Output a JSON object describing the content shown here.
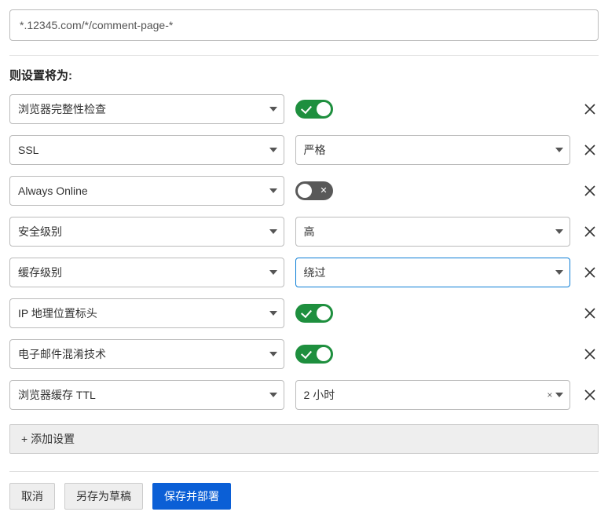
{
  "url_pattern": "*.12345.com/*/comment-page-*",
  "section_title": "则设置将为:",
  "rows": [
    {
      "setting": "浏览器完整性检查",
      "type": "toggle",
      "value_on": true
    },
    {
      "setting": "SSL",
      "type": "select",
      "value": "严格"
    },
    {
      "setting": "Always Online",
      "type": "toggle",
      "value_on": false
    },
    {
      "setting": "安全级别",
      "type": "select",
      "value": "高"
    },
    {
      "setting": "缓存级别",
      "type": "select",
      "value": "绕过",
      "highlighted": true
    },
    {
      "setting": "IP 地理位置标头",
      "type": "toggle",
      "value_on": true
    },
    {
      "setting": "电子邮件混淆技术",
      "type": "toggle",
      "value_on": true
    },
    {
      "setting": "浏览器缓存 TTL",
      "type": "select",
      "value": "2 小时",
      "clearable": true
    }
  ],
  "add_setting_label": "+ 添加设置",
  "footer": {
    "cancel": "取消",
    "save_draft": "另存为草稿",
    "save_deploy": "保存并部署"
  }
}
